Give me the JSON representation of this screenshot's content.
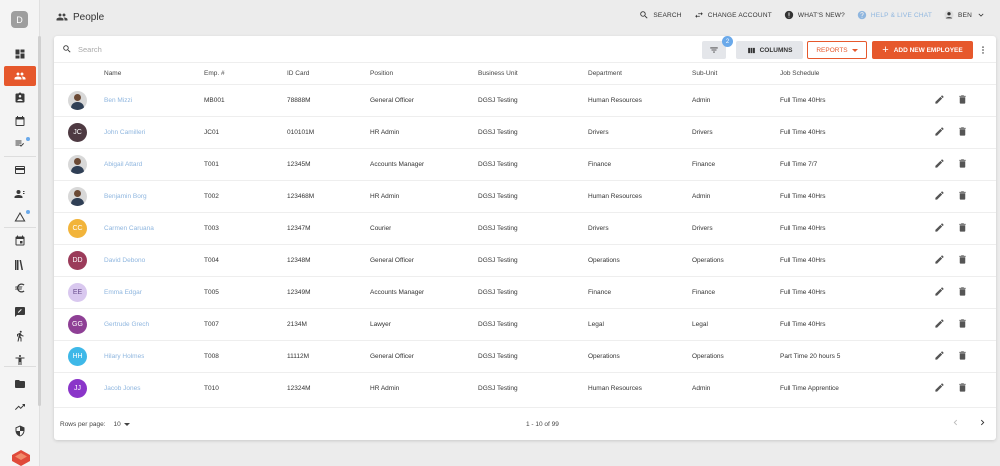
{
  "sidebar": {
    "logo_letter": "D",
    "items": [
      {
        "icon": "dashboard-icon"
      },
      {
        "icon": "people-icon",
        "active": true
      },
      {
        "icon": "id-badge-icon"
      },
      {
        "icon": "calendar-icon"
      },
      {
        "icon": "checklist-icon",
        "dot": true
      },
      {
        "icon": "card-icon"
      },
      {
        "icon": "user-switch-icon"
      },
      {
        "icon": "warning-icon",
        "dot": true
      },
      {
        "icon": "event-icon"
      },
      {
        "icon": "book-icon"
      },
      {
        "icon": "euro-icon"
      },
      {
        "icon": "chat-icon"
      },
      {
        "icon": "run-icon"
      },
      {
        "icon": "accessibility-icon"
      },
      {
        "icon": "folder-icon"
      },
      {
        "icon": "trending-icon"
      },
      {
        "icon": "shield-icon"
      }
    ]
  },
  "header": {
    "title": "People",
    "search": "SEARCH",
    "change_account": "CHANGE ACCOUNT",
    "whats_new": "WHAT'S NEW?",
    "help": "HELP & LIVE CHAT",
    "user": "BEN"
  },
  "toolbar": {
    "search_placeholder": "Search",
    "filter_badge": "2",
    "columns": "COLUMNS",
    "reports": "REPORTS",
    "add_employee": "ADD NEW EMPLOYEE"
  },
  "table": {
    "columns": [
      "Name",
      "Emp. #",
      "ID Card",
      "Position",
      "Business Unit",
      "Department",
      "Sub-Unit",
      "Job Schedule"
    ],
    "rows": [
      {
        "initials": "",
        "photo": true,
        "color": "#d8d8d8",
        "name": "Ben Mizzi",
        "emp": "MB001",
        "id": "78888M",
        "position": "General Officer",
        "unit": "DGSJ Testing",
        "dept": "Human Resources",
        "sub": "Admin",
        "schedule": "Full Time 40Hrs"
      },
      {
        "initials": "JC",
        "photo": false,
        "color": "#4e3a42",
        "name": "John Camilleri",
        "emp": "JC01",
        "id": "010101M",
        "position": "HR Admin",
        "unit": "DGSJ Testing",
        "dept": "Drivers",
        "sub": "Drivers",
        "schedule": "Full Time 40Hrs"
      },
      {
        "initials": "",
        "photo": true,
        "color": "#d8d8d8",
        "name": "Abigail Attard",
        "emp": "T001",
        "id": "12345M",
        "position": "Accounts Manager",
        "unit": "DGSJ Testing",
        "dept": "Finance",
        "sub": "Finance",
        "schedule": "Full Time 7/7"
      },
      {
        "initials": "",
        "photo": true,
        "color": "#d8d8d8",
        "name": "Benjamin Borg",
        "emp": "T002",
        "id": "123468M",
        "position": "HR Admin",
        "unit": "DGSJ Testing",
        "dept": "Human Resources",
        "sub": "Admin",
        "schedule": "Full Time 40Hrs"
      },
      {
        "initials": "CC",
        "photo": false,
        "color": "#f2b43a",
        "name": "Carmen Caruana",
        "emp": "T003",
        "id": "12347M",
        "position": "Courier",
        "unit": "DGSJ Testing",
        "dept": "Drivers",
        "sub": "Drivers",
        "schedule": "Full Time 40Hrs"
      },
      {
        "initials": "DD",
        "photo": false,
        "color": "#9b3b5a",
        "name": "David Debono",
        "emp": "T004",
        "id": "12348M",
        "position": "General Officer",
        "unit": "DGSJ Testing",
        "dept": "Operations",
        "sub": "Operations",
        "schedule": "Full Time 40Hrs"
      },
      {
        "initials": "EE",
        "photo": false,
        "color": "#d9c8ef",
        "name": "Emma Edgar",
        "emp": "T005",
        "id": "12349M",
        "position": "Accounts Manager",
        "unit": "DGSJ Testing",
        "dept": "Finance",
        "sub": "Finance",
        "schedule": "Full Time 40Hrs"
      },
      {
        "initials": "GG",
        "photo": false,
        "color": "#8e3f95",
        "name": "Gertrude Grech",
        "emp": "T007",
        "id": "2134M",
        "position": "Lawyer",
        "unit": "DGSJ Testing",
        "dept": "Legal",
        "sub": "Legal",
        "schedule": "Full Time 40Hrs"
      },
      {
        "initials": "HH",
        "photo": false,
        "color": "#3eb8e8",
        "name": "Hilary Holmes",
        "emp": "T008",
        "id": "11112M",
        "position": "General Officer",
        "unit": "DGSJ Testing",
        "dept": "Operations",
        "sub": "Operations",
        "schedule": "Part Time 20 hours 5"
      },
      {
        "initials": "JJ",
        "photo": false,
        "color": "#8a35c9",
        "name": "Jacob Jones",
        "emp": "T010",
        "id": "12324M",
        "position": "HR Admin",
        "unit": "DGSJ Testing",
        "dept": "Human Resources",
        "sub": "Admin",
        "schedule": "Full Time Apprentice"
      }
    ]
  },
  "footer": {
    "rows_per_page_label": "Rows per page:",
    "rows_per_page": "10",
    "range": "1 - 10 of 99"
  },
  "colors": {
    "accent": "#e6582c",
    "link": "#8fb6df",
    "badge": "#6aa9ea"
  }
}
